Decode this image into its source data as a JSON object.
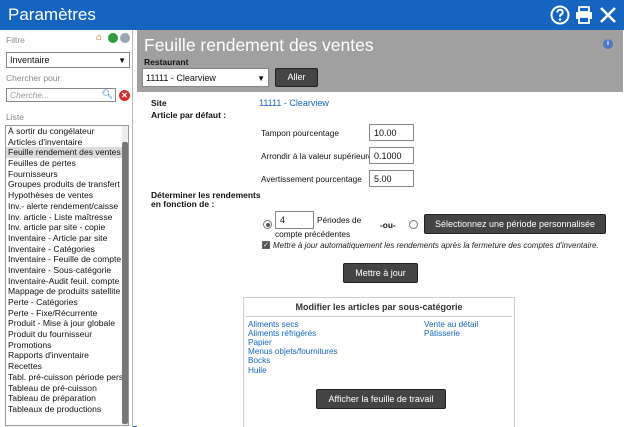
{
  "window": {
    "title": "Paramètres",
    "icons": [
      "help-icon",
      "print-icon",
      "close-icon"
    ]
  },
  "sidebar": {
    "filter_label": "Filtre",
    "filter_select": "Inventaire",
    "search_label": "Chercher pour",
    "search_placeholder": "Cherche...",
    "list_label": "Liste",
    "items": [
      "À sortir du congélateur",
      "Articles d'inventaire",
      "Feuille rendement des ventes",
      "Feuilles de pertes",
      "Fournisseurs",
      "Groupes produits de transfert",
      "Hypothèses de ventes",
      "Inv.- alerte rendement/caisse",
      "Inv. article - Liste maîtresse",
      "Inv. article par site - copie",
      "Inventaire - Article par site",
      "Inventaire - Catégories",
      "Inventaire - Feuille de compte",
      "Inventaire - Sous-catégorie",
      "Inventaire-Audit feuil. compte",
      "Mappage de produits satellite",
      "Perte - Catégories",
      "Perte - Fixe/Récurrente",
      "Produit - Mise à jour globale",
      "Produit du fournisseur",
      "Promotions",
      "Rapports d'inventaire",
      "Recettes",
      "Tabl. pré-cuisson période pers",
      "Tableau de pré-cuisson",
      "Tableau de préparation",
      "Tableaux de productions"
    ],
    "selected_index": 2
  },
  "main": {
    "title": "Feuille rendement des ventes",
    "restaurant_label": "Restaurant",
    "restaurant_select": "11111 - Clearview",
    "go_button": "Aller",
    "site_label": "Site",
    "site_value": "11111 - Clearview",
    "default_item_label": "Article par défaut :",
    "fields": [
      {
        "label": "Tampon pourcentage",
        "value": "10.00"
      },
      {
        "label": "Arrondir à la valeur supérieure",
        "value": "0.1000"
      },
      {
        "label": "Avertissement pourcentage",
        "value": "5.00"
      }
    ],
    "determine_label_1": "Déterminer les rendements",
    "determine_label_2": "en fonction de :",
    "periods_value": "4",
    "periods_label_1": "Périodes de",
    "periods_label_2": "compte précédentes",
    "or_label": "-ou-",
    "custom_period_button": "Sélectionnez une période personnalisée",
    "auto_update_note": "Mettre à jour automatiquement les rendements après la fermeture des comptes d'inventaire.",
    "update_button": "Mettre à jour",
    "subcat_title": "Modifier les articles par sous-catégorie",
    "subcat_col1": [
      "Aliments secs",
      "Aliments réfrigérés",
      "Papier",
      "Menus objets/fournitures",
      "Bocks",
      "Huile"
    ],
    "subcat_col2": [
      "Vente au détail",
      "Pâtisserie"
    ],
    "worksheet_button": "Afficher la feuille de travail"
  },
  "colors": {
    "titlebar": "#1565c0",
    "header_strip": "#a0a0a0",
    "link": "#1565c0",
    "dark_button": "#444444"
  }
}
